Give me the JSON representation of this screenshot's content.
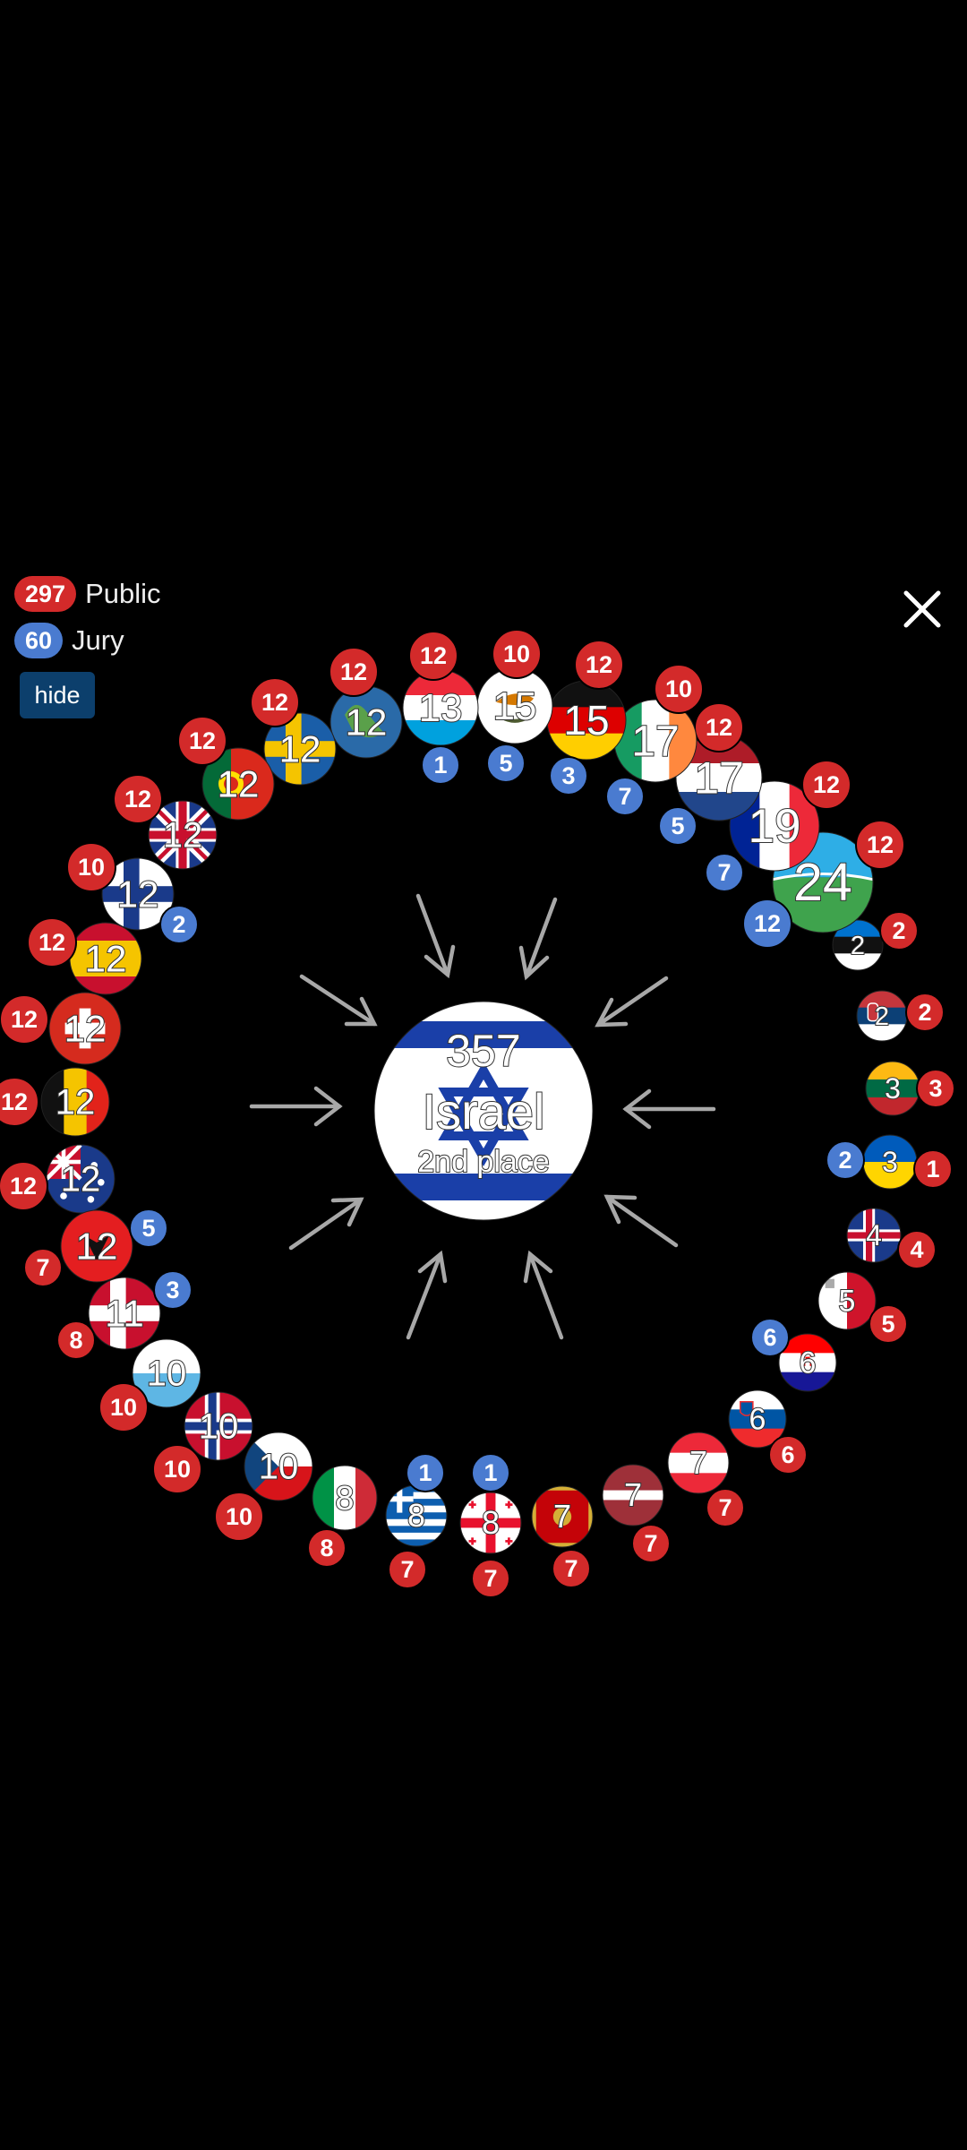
{
  "legend": {
    "public_total": "297",
    "public_label": "Public",
    "jury_total": "60",
    "jury_label": "Jury",
    "hide_label": "hide"
  },
  "center": {
    "points": "357",
    "country": "Israel",
    "place": "2nd place"
  },
  "colors": {
    "public": "#d32a2a",
    "jury": "#4a7bd0",
    "background": "#000000"
  },
  "voters": [
    {
      "flag": "UK",
      "total": "12",
      "public": "12",
      "jury": ""
    },
    {
      "flag": "Finland",
      "total": "12",
      "public": "10",
      "jury": "2"
    },
    {
      "flag": "Spain",
      "total": "12",
      "public": "12",
      "jury": ""
    },
    {
      "flag": "Switzerland",
      "total": "12",
      "public": "12",
      "jury": ""
    },
    {
      "flag": "Belgium",
      "total": "12",
      "public": "12",
      "jury": ""
    },
    {
      "flag": "Australia",
      "total": "12",
      "public": "12",
      "jury": ""
    },
    {
      "flag": "Albania",
      "total": "12",
      "public": "7",
      "jury": "5"
    },
    {
      "flag": "Denmark",
      "total": "11",
      "public": "8",
      "jury": "3"
    },
    {
      "flag": "San Marino",
      "total": "10",
      "public": "10",
      "jury": ""
    },
    {
      "flag": "Norway",
      "total": "10",
      "public": "10",
      "jury": ""
    },
    {
      "flag": "Czechia",
      "total": "10",
      "public": "10",
      "jury": ""
    },
    {
      "flag": "Italy",
      "total": "8",
      "public": "8",
      "jury": ""
    },
    {
      "flag": "Greece",
      "total": "8",
      "public": "7",
      "jury": "1"
    },
    {
      "flag": "Georgia",
      "total": "8",
      "public": "7",
      "jury": "1"
    },
    {
      "flag": "Montenegro",
      "total": "7",
      "public": "7",
      "jury": ""
    },
    {
      "flag": "Latvia",
      "total": "7",
      "public": "7",
      "jury": ""
    },
    {
      "flag": "Austria",
      "total": "7",
      "public": "7",
      "jury": ""
    },
    {
      "flag": "Slovenia",
      "total": "6",
      "public": "6",
      "jury": ""
    },
    {
      "flag": "Croatia",
      "total": "6",
      "public": "",
      "jury": "6"
    },
    {
      "flag": "Malta",
      "total": "5",
      "public": "5",
      "jury": ""
    },
    {
      "flag": "Iceland",
      "total": "4",
      "public": "4",
      "jury": ""
    },
    {
      "flag": "Ukraine",
      "total": "3",
      "public": "1",
      "jury": "2"
    },
    {
      "flag": "Lithuania",
      "total": "3",
      "public": "3",
      "jury": ""
    },
    {
      "flag": "Serbia",
      "total": "2",
      "public": "2",
      "jury": ""
    },
    {
      "flag": "Estonia",
      "total": "2",
      "public": "2",
      "jury": ""
    },
    {
      "flag": "Rest of World",
      "total": "24",
      "public": "12",
      "jury": "12"
    },
    {
      "flag": "France",
      "total": "19",
      "public": "12",
      "jury": "7"
    },
    {
      "flag": "Netherlands",
      "total": "17",
      "public": "12",
      "jury": "5"
    },
    {
      "flag": "Ireland",
      "total": "17",
      "public": "10",
      "jury": "7"
    },
    {
      "flag": "Germany",
      "total": "15",
      "public": "12",
      "jury": "3"
    },
    {
      "flag": "Cyprus",
      "total": "15",
      "public": "10",
      "jury": "5"
    },
    {
      "flag": "Luxembourg",
      "total": "13",
      "public": "12",
      "jury": "1"
    },
    {
      "flag": "Rest of World",
      "total": "12",
      "public": "12",
      "jury": ""
    },
    {
      "flag": "Sweden",
      "total": "12",
      "public": "12",
      "jury": ""
    },
    {
      "flag": "Portugal",
      "total": "12",
      "public": "12",
      "jury": ""
    }
  ]
}
